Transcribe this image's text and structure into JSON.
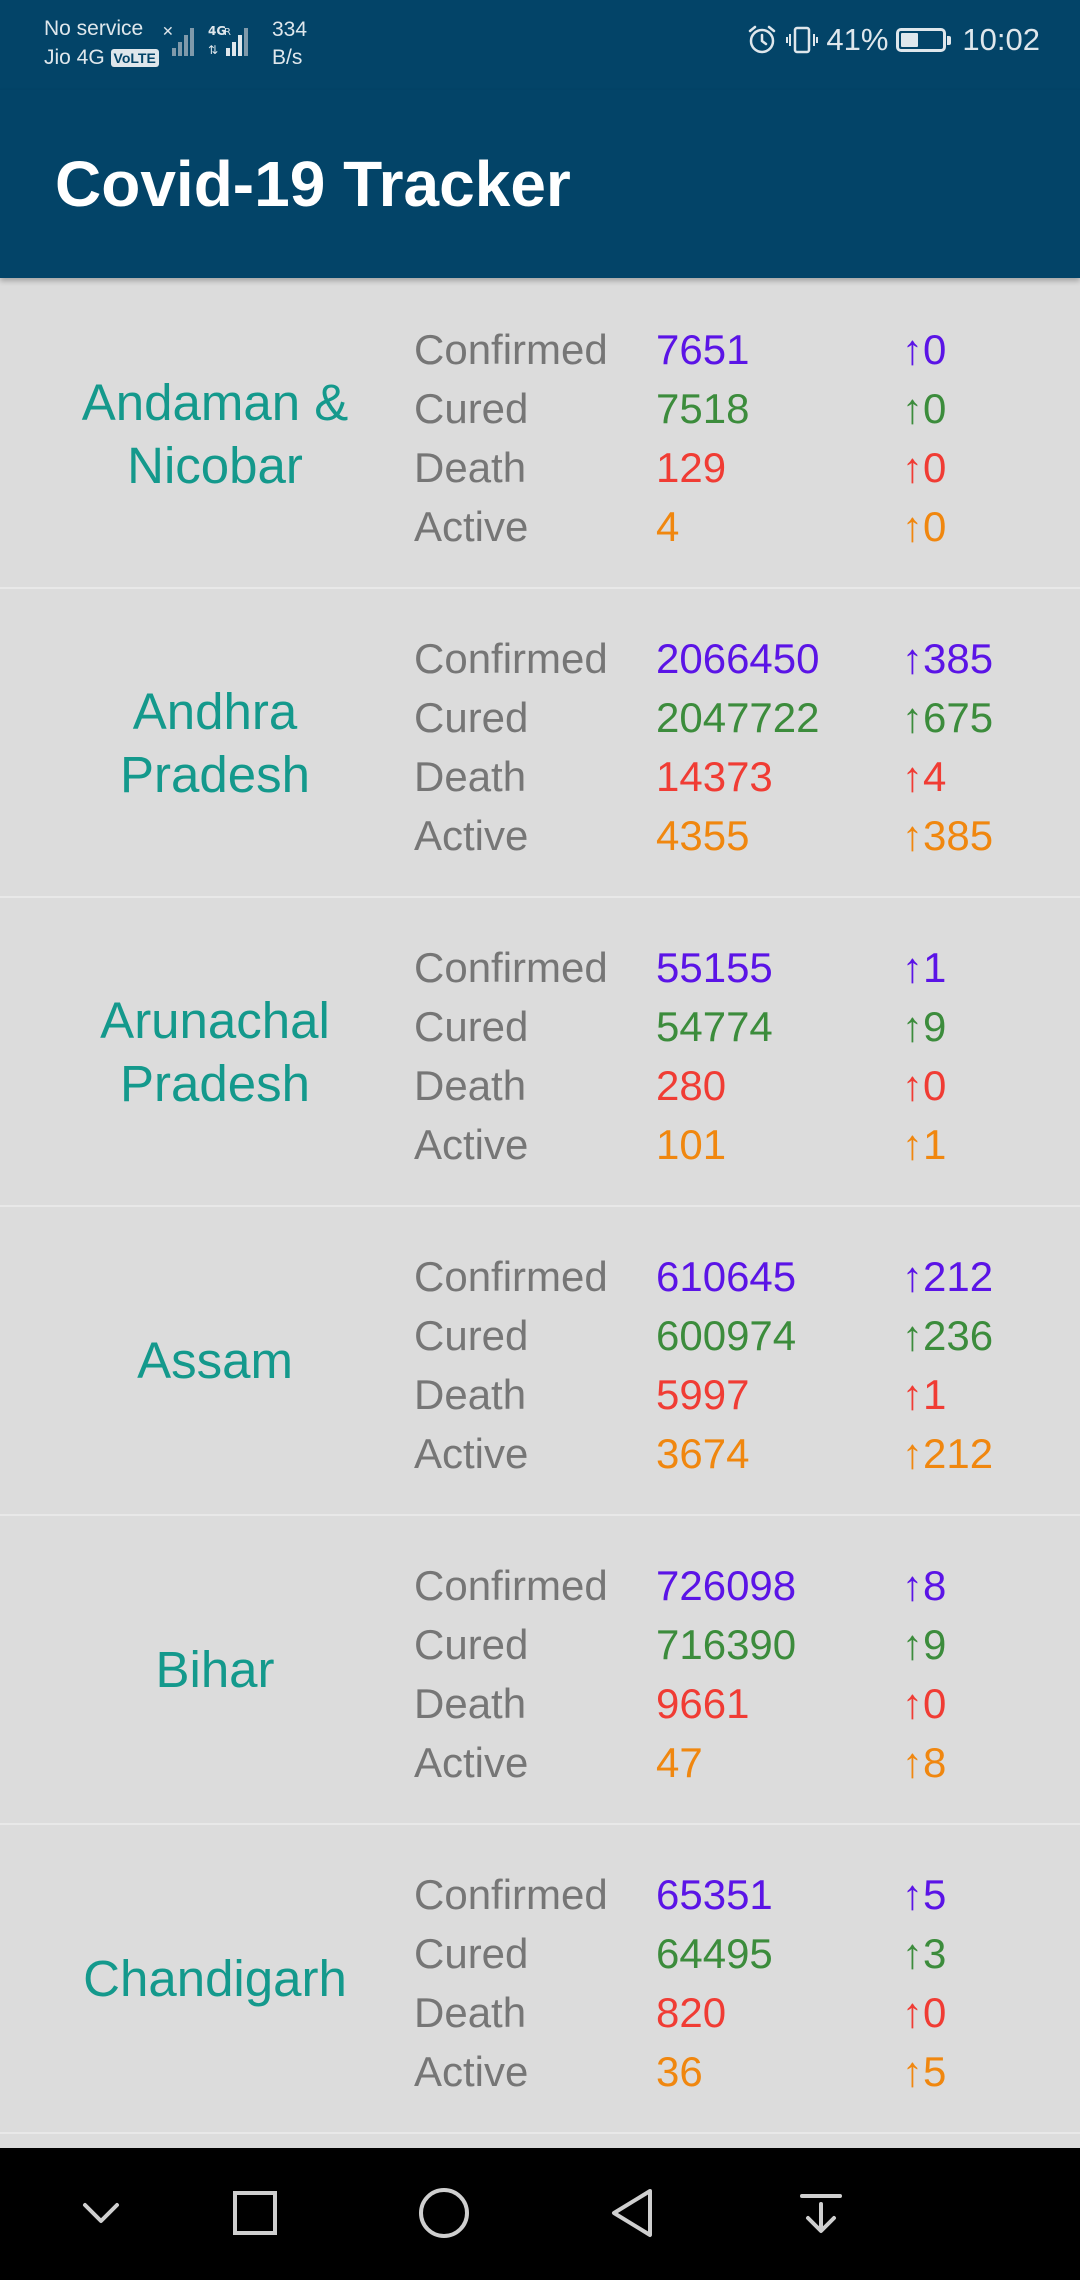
{
  "status_bar": {
    "carrier_top": "No service",
    "carrier_bottom": "Jio 4G",
    "volte": "VoLTE",
    "net_speed_value": "334",
    "net_speed_unit": "B/s",
    "battery_percent": "41%",
    "battery_level": 0.41,
    "time": "10:02"
  },
  "app_bar": {
    "title": "Covid-19 Tracker"
  },
  "stat_labels": {
    "confirmed": "Confirmed",
    "cured": "Cured",
    "death": "Death",
    "active": "Active"
  },
  "colors": {
    "app_bar": "#034468",
    "state_name": "#14998c",
    "confirmed": "#5b14e6",
    "cured": "#3c8c3c",
    "death": "#f03c34",
    "active": "#f0870f"
  },
  "states": [
    {
      "name": "Andaman & Nicobar",
      "confirmed": "7651",
      "confirmed_delta": "↑0",
      "cured": "7518",
      "cured_delta": "↑0",
      "death": "129",
      "death_delta": "↑0",
      "active": "4",
      "active_delta": "↑0"
    },
    {
      "name": "Andhra Pradesh",
      "confirmed": "2066450",
      "confirmed_delta": "↑385",
      "cured": "2047722",
      "cured_delta": "↑675",
      "death": "14373",
      "death_delta": "↑4",
      "active": "4355",
      "active_delta": "↑385"
    },
    {
      "name": "Arunachal Pradesh",
      "confirmed": "55155",
      "confirmed_delta": "↑1",
      "cured": "54774",
      "cured_delta": "↑9",
      "death": "280",
      "death_delta": "↑0",
      "active": "101",
      "active_delta": "↑1"
    },
    {
      "name": "Assam",
      "confirmed": "610645",
      "confirmed_delta": "↑212",
      "cured": "600974",
      "cured_delta": "↑236",
      "death": "5997",
      "death_delta": "↑1",
      "active": "3674",
      "active_delta": "↑212"
    },
    {
      "name": "Bihar",
      "confirmed": "726098",
      "confirmed_delta": "↑8",
      "cured": "716390",
      "cured_delta": "↑9",
      "death": "9661",
      "death_delta": "↑0",
      "active": "47",
      "active_delta": "↑8"
    },
    {
      "name": "Chandigarh",
      "confirmed": "65351",
      "confirmed_delta": "↑5",
      "cured": "64495",
      "cured_delta": "↑3",
      "death": "820",
      "death_delta": "↑0",
      "active": "36",
      "active_delta": "↑5"
    }
  ],
  "nav_bar": {
    "icons": [
      "chevron-down-icon",
      "recents-square-icon",
      "home-circle-icon",
      "back-triangle-icon",
      "notification-pull-icon"
    ]
  }
}
